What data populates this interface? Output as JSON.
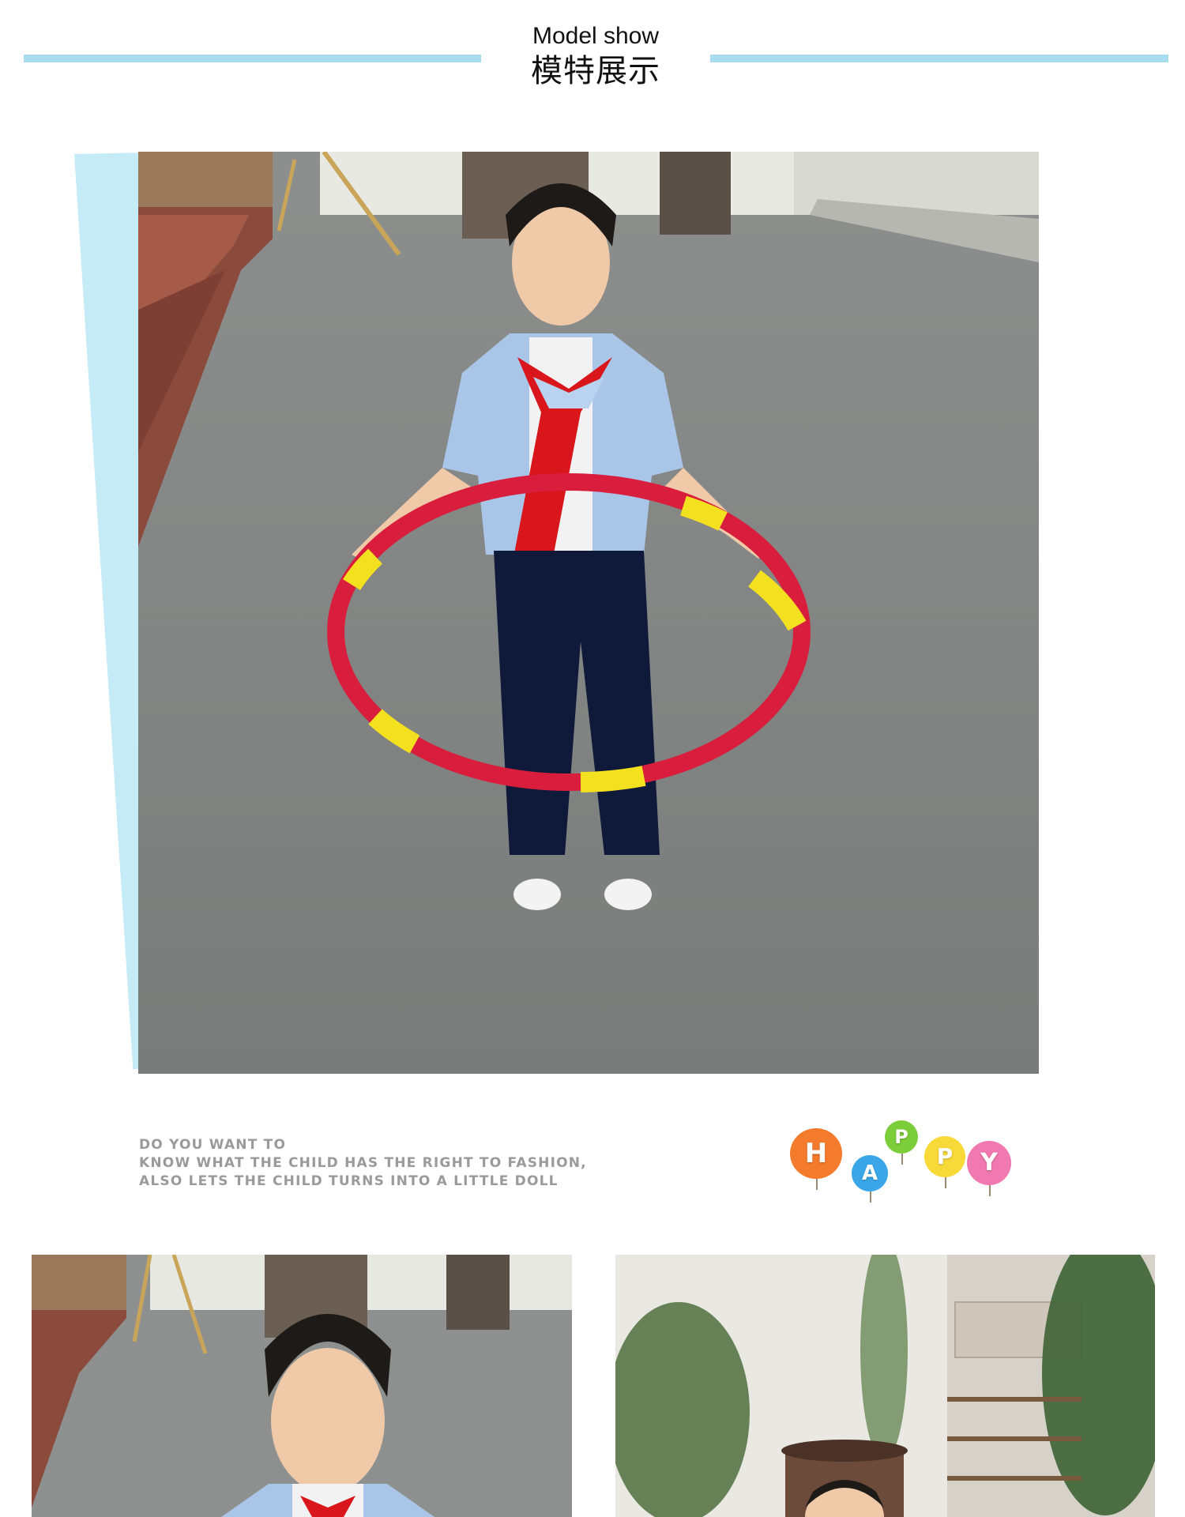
{
  "header": {
    "title_en": "Model show",
    "title_zh": "模特展示"
  },
  "tagline": {
    "lines": [
      "DO YOU WANT TO",
      "KNOW WHAT THE CHILD HAS THE RIGHT TO FASHION,",
      "ALSO LETS THE CHILD TURNS INTO A LITTLE DOLL"
    ]
  },
  "happy_badge": {
    "letters": [
      {
        "char": "H",
        "color": "#f47a2c"
      },
      {
        "char": "A",
        "color": "#3aa6e8"
      },
      {
        "char": "P",
        "color": "#7ccd3a"
      },
      {
        "char": "P",
        "color": "#f7d93a"
      },
      {
        "char": "Y",
        "color": "#ef79b0"
      }
    ]
  },
  "colors": {
    "accent": "#a9dcef",
    "backdrop": "#c5ebf6"
  }
}
